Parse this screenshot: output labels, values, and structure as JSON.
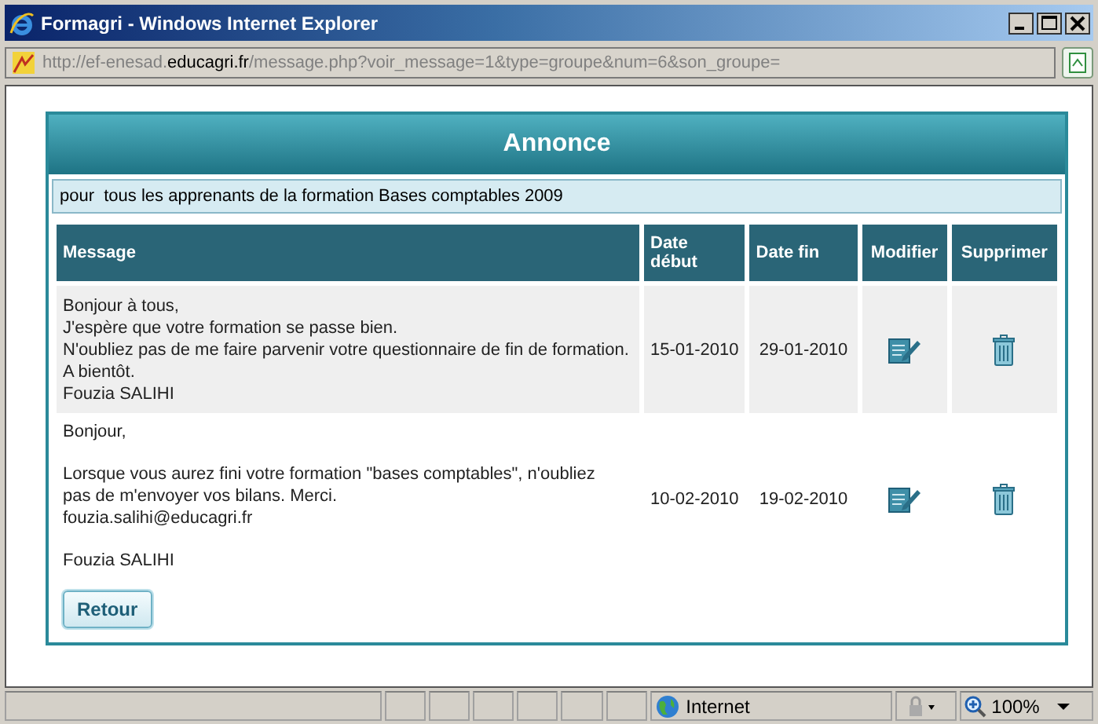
{
  "window": {
    "title": "Formagri - Windows Internet Explorer"
  },
  "address": {
    "prefix": "http://ef-enesad.",
    "domain": "educagri.fr",
    "path": "/message.php?voir_message=1&type=groupe&num=6&son_groupe="
  },
  "panel": {
    "title": "Annonce",
    "audience": "pour  tous les apprenants de la formation Bases comptables 2009"
  },
  "table": {
    "columns": [
      "Message",
      "Date début",
      "Date fin",
      "Modifier",
      "Supprimer"
    ],
    "rows": [
      {
        "paragraphs": [
          [
            "Bonjour à tous,",
            "J'espère que votre formation se passe bien.",
            "N'oubliez pas de me faire parvenir votre questionnaire de fin de formation.",
            "A bientôt.",
            "Fouzia SALIHI"
          ]
        ],
        "start": "15-01-2010",
        "end": "29-01-2010"
      },
      {
        "paragraphs": [
          [
            "Bonjour,"
          ],
          [
            "Lorsque vous aurez fini votre formation \"bases comptables\", n'oubliez",
            "pas de m'envoyer vos bilans. Merci.",
            "fouzia.salihi@educagri.fr"
          ],
          [
            "Fouzia SALIHI"
          ]
        ],
        "start": "10-02-2010",
        "end": "19-02-2010"
      }
    ]
  },
  "back_button": "Retour",
  "status_bar": {
    "zone": "Internet",
    "zoom": "100%"
  }
}
